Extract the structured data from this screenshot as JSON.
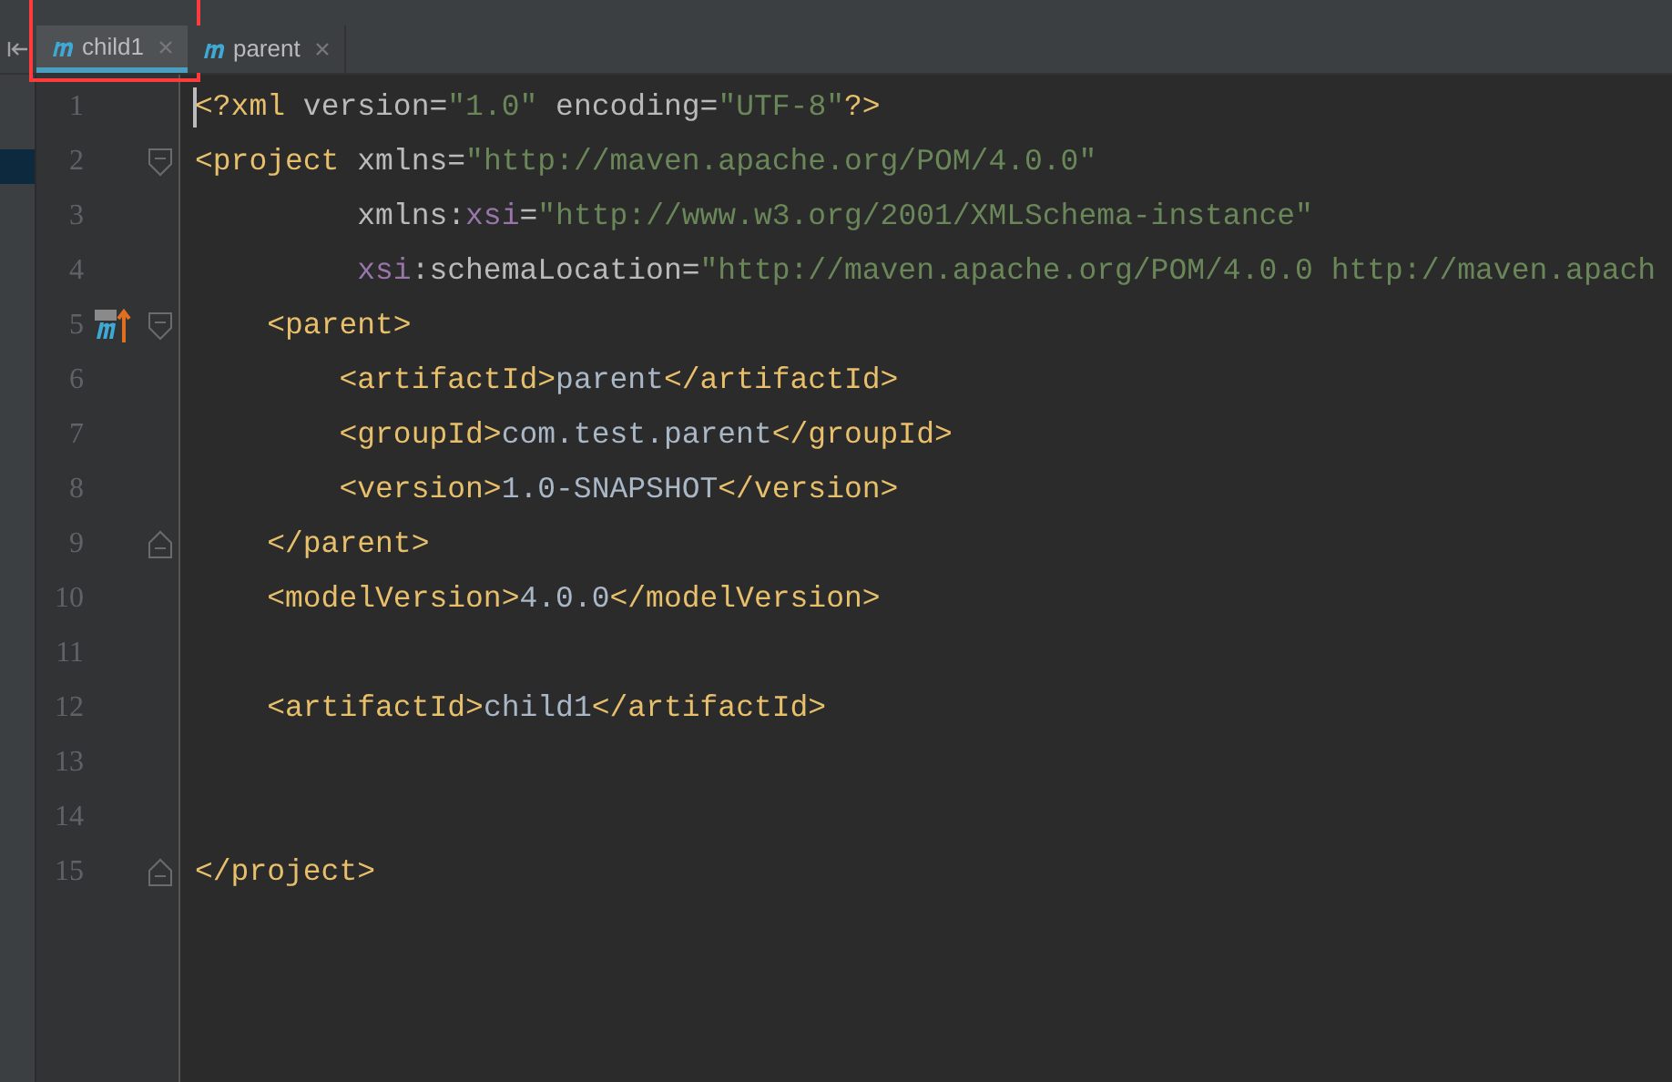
{
  "tabs": [
    {
      "label": "child1",
      "selected": true,
      "highlighted": true
    },
    {
      "label": "parent",
      "selected": false,
      "highlighted": false
    }
  ],
  "editor": {
    "lines": [
      {
        "number": "1",
        "fold_start": false,
        "fold_end": false,
        "marker": false,
        "caret": true,
        "tokens": [
          {
            "kind": "tag",
            "text": "<?xml "
          },
          {
            "kind": "attr",
            "text": "version="
          },
          {
            "kind": "value",
            "text": "\"1.0\""
          },
          {
            "kind": "attr",
            "text": " encoding="
          },
          {
            "kind": "value",
            "text": "\"UTF-8\""
          },
          {
            "kind": "tag",
            "text": "?>"
          }
        ]
      },
      {
        "number": "2",
        "fold_start": true,
        "fold_end": false,
        "marker": false,
        "caret": false,
        "tokens": [
          {
            "kind": "tag",
            "text": "<project "
          },
          {
            "kind": "attr",
            "text": "xmlns="
          },
          {
            "kind": "value",
            "text": "\"http://maven.apache.org/POM/4.0.0\""
          }
        ]
      },
      {
        "number": "3",
        "fold_start": false,
        "fold_end": false,
        "marker": false,
        "caret": false,
        "tokens": [
          {
            "kind": "attr",
            "text": "         xmlns:"
          },
          {
            "kind": "ns",
            "text": "xsi"
          },
          {
            "kind": "attr",
            "text": "="
          },
          {
            "kind": "value",
            "text": "\"http://www.w3.org/2001/XMLSchema-instance\""
          }
        ]
      },
      {
        "number": "4",
        "fold_start": false,
        "fold_end": false,
        "marker": false,
        "caret": false,
        "tokens": [
          {
            "kind": "ns",
            "text": "         xsi"
          },
          {
            "kind": "attr",
            "text": ":schemaLocation="
          },
          {
            "kind": "value",
            "text": "\"http://maven.apache.org/POM/4.0.0 http://maven.apach"
          }
        ]
      },
      {
        "number": "5",
        "fold_start": true,
        "fold_end": false,
        "marker": true,
        "caret": false,
        "tokens": [
          {
            "kind": "tag",
            "text": "    <parent>"
          }
        ]
      },
      {
        "number": "6",
        "fold_start": false,
        "fold_end": false,
        "marker": false,
        "caret": false,
        "tokens": [
          {
            "kind": "tag",
            "text": "        <artifactId>"
          },
          {
            "kind": "text",
            "text": "parent"
          },
          {
            "kind": "tag",
            "text": "</artifactId>"
          }
        ]
      },
      {
        "number": "7",
        "fold_start": false,
        "fold_end": false,
        "marker": false,
        "caret": false,
        "tokens": [
          {
            "kind": "tag",
            "text": "        <groupId>"
          },
          {
            "kind": "text",
            "text": "com.test.parent"
          },
          {
            "kind": "tag",
            "text": "</groupId>"
          }
        ]
      },
      {
        "number": "8",
        "fold_start": false,
        "fold_end": false,
        "marker": false,
        "caret": false,
        "tokens": [
          {
            "kind": "tag",
            "text": "        <version>"
          },
          {
            "kind": "text",
            "text": "1.0-SNAPSHOT"
          },
          {
            "kind": "tag",
            "text": "</version>"
          }
        ]
      },
      {
        "number": "9",
        "fold_start": false,
        "fold_end": true,
        "marker": false,
        "caret": false,
        "tokens": [
          {
            "kind": "tag",
            "text": "    </parent>"
          }
        ]
      },
      {
        "number": "10",
        "fold_start": false,
        "fold_end": false,
        "marker": false,
        "caret": false,
        "tokens": [
          {
            "kind": "tag",
            "text": "    <modelVersion>"
          },
          {
            "kind": "text",
            "text": "4.0.0"
          },
          {
            "kind": "tag",
            "text": "</modelVersion>"
          }
        ]
      },
      {
        "number": "11",
        "fold_start": false,
        "fold_end": false,
        "marker": false,
        "caret": false
      },
      {
        "number": "12",
        "fold_start": false,
        "fold_end": false,
        "marker": false,
        "caret": false,
        "tokens": [
          {
            "kind": "tag",
            "text": "    <artifactId>"
          },
          {
            "kind": "text",
            "text": "child1"
          },
          {
            "kind": "tag",
            "text": "</artifactId>"
          }
        ]
      },
      {
        "number": "13",
        "fold_start": false,
        "fold_end": false,
        "marker": false,
        "caret": false
      },
      {
        "number": "14",
        "fold_start": false,
        "fold_end": false,
        "marker": false,
        "caret": false
      },
      {
        "number": "15",
        "fold_start": false,
        "fold_end": true,
        "marker": false,
        "caret": false,
        "tokens": [
          {
            "kind": "tag",
            "text": "</project>"
          }
        ]
      }
    ]
  }
}
